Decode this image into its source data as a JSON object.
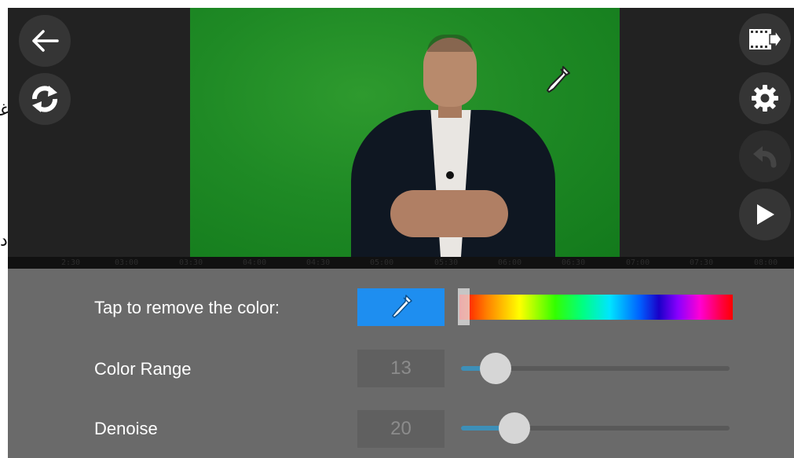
{
  "toolbar_left": {
    "back": {
      "icon": "arrow-left-icon"
    },
    "refresh": {
      "icon": "refresh-icon"
    }
  },
  "toolbar_right": {
    "export": {
      "icon": "film-export-icon"
    },
    "settings": {
      "icon": "gear-icon"
    },
    "undo": {
      "icon": "undo-icon",
      "enabled": false
    },
    "play": {
      "icon": "play-icon"
    }
  },
  "timeline": {
    "ticks": [
      "2:30",
      "03:00",
      "03:30",
      "04:00",
      "04:30",
      "05:00",
      "05:30",
      "06:00",
      "06:30",
      "07:00",
      "07:30",
      "08:00"
    ]
  },
  "controls": {
    "remove_color_label": "Tap to remove the color:",
    "picker_icon": "eyedropper-icon",
    "picker_color": "#1e8ef0",
    "hue_selection": 0.02,
    "color_range": {
      "label": "Color Range",
      "value": "13",
      "level": 0.13
    },
    "denoise": {
      "label": "Denoise",
      "value": "20",
      "level": 0.2
    }
  }
}
